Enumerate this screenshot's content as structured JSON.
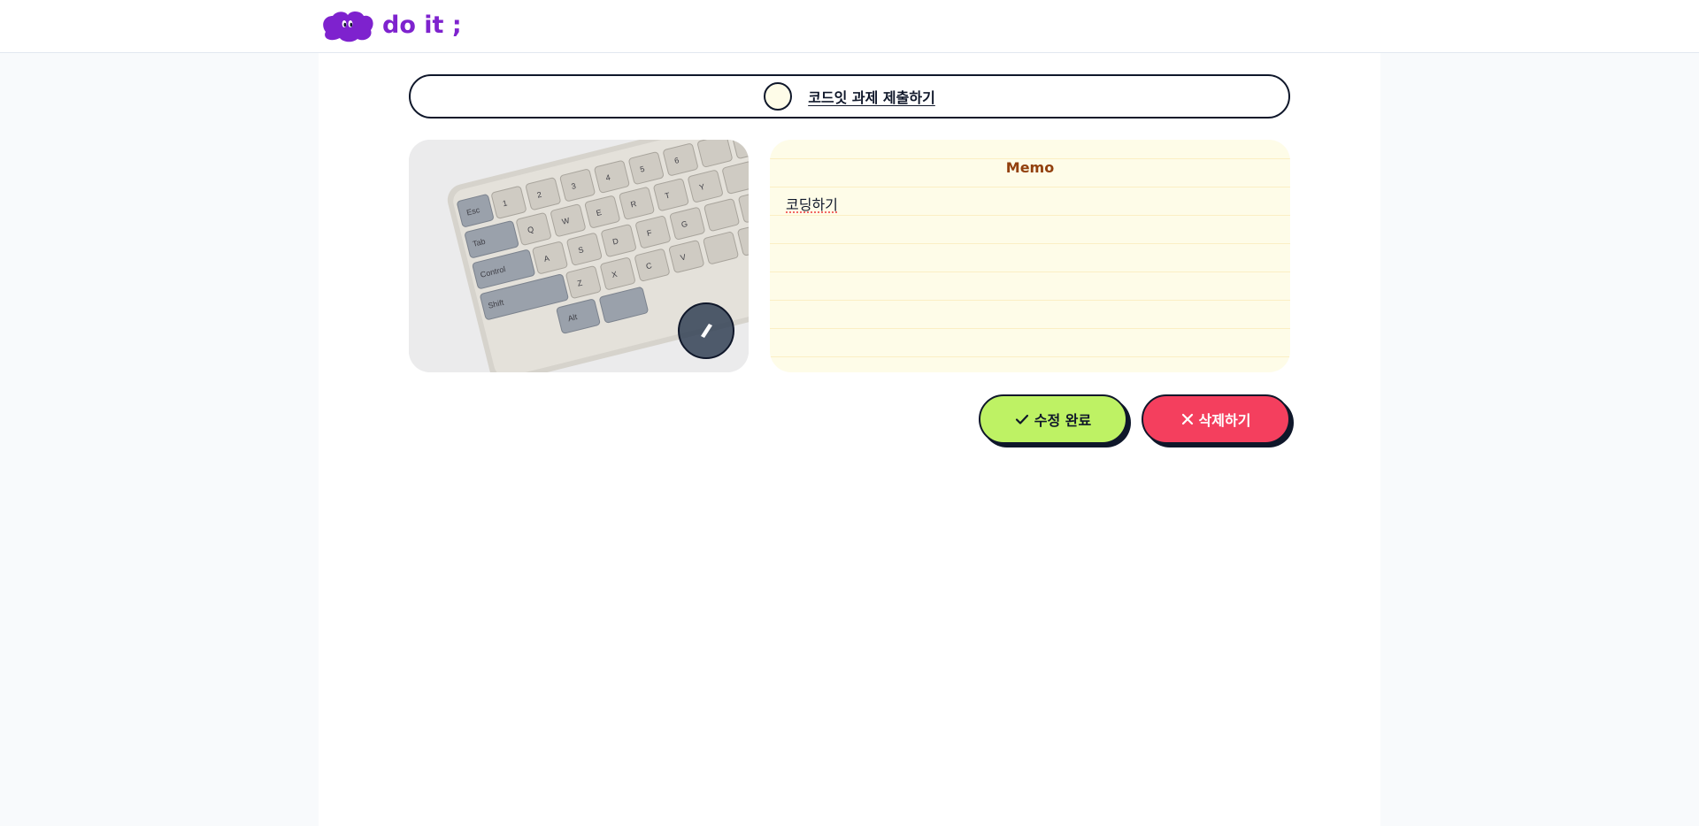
{
  "header": {
    "logo_text": "do it ;",
    "logo_icon": "cloud-eyes-logo",
    "brand_color": "#7e22ce"
  },
  "todo": {
    "title": "코드잇 과제 제출하기",
    "completed": false,
    "check_icon": "circle-checkbox-icon"
  },
  "image": {
    "subject": "keyboard-photo",
    "edit_icon": "pencil-icon"
  },
  "memo": {
    "title": "Memo",
    "content": "코딩하기",
    "title_color": "#92400e",
    "background": "#fefce8"
  },
  "actions": {
    "save_label": "수정 완료",
    "save_icon": "check-icon",
    "save_color": "#bef264",
    "delete_label": "삭제하기",
    "delete_icon": "x-icon",
    "delete_color": "#f43f5e"
  }
}
